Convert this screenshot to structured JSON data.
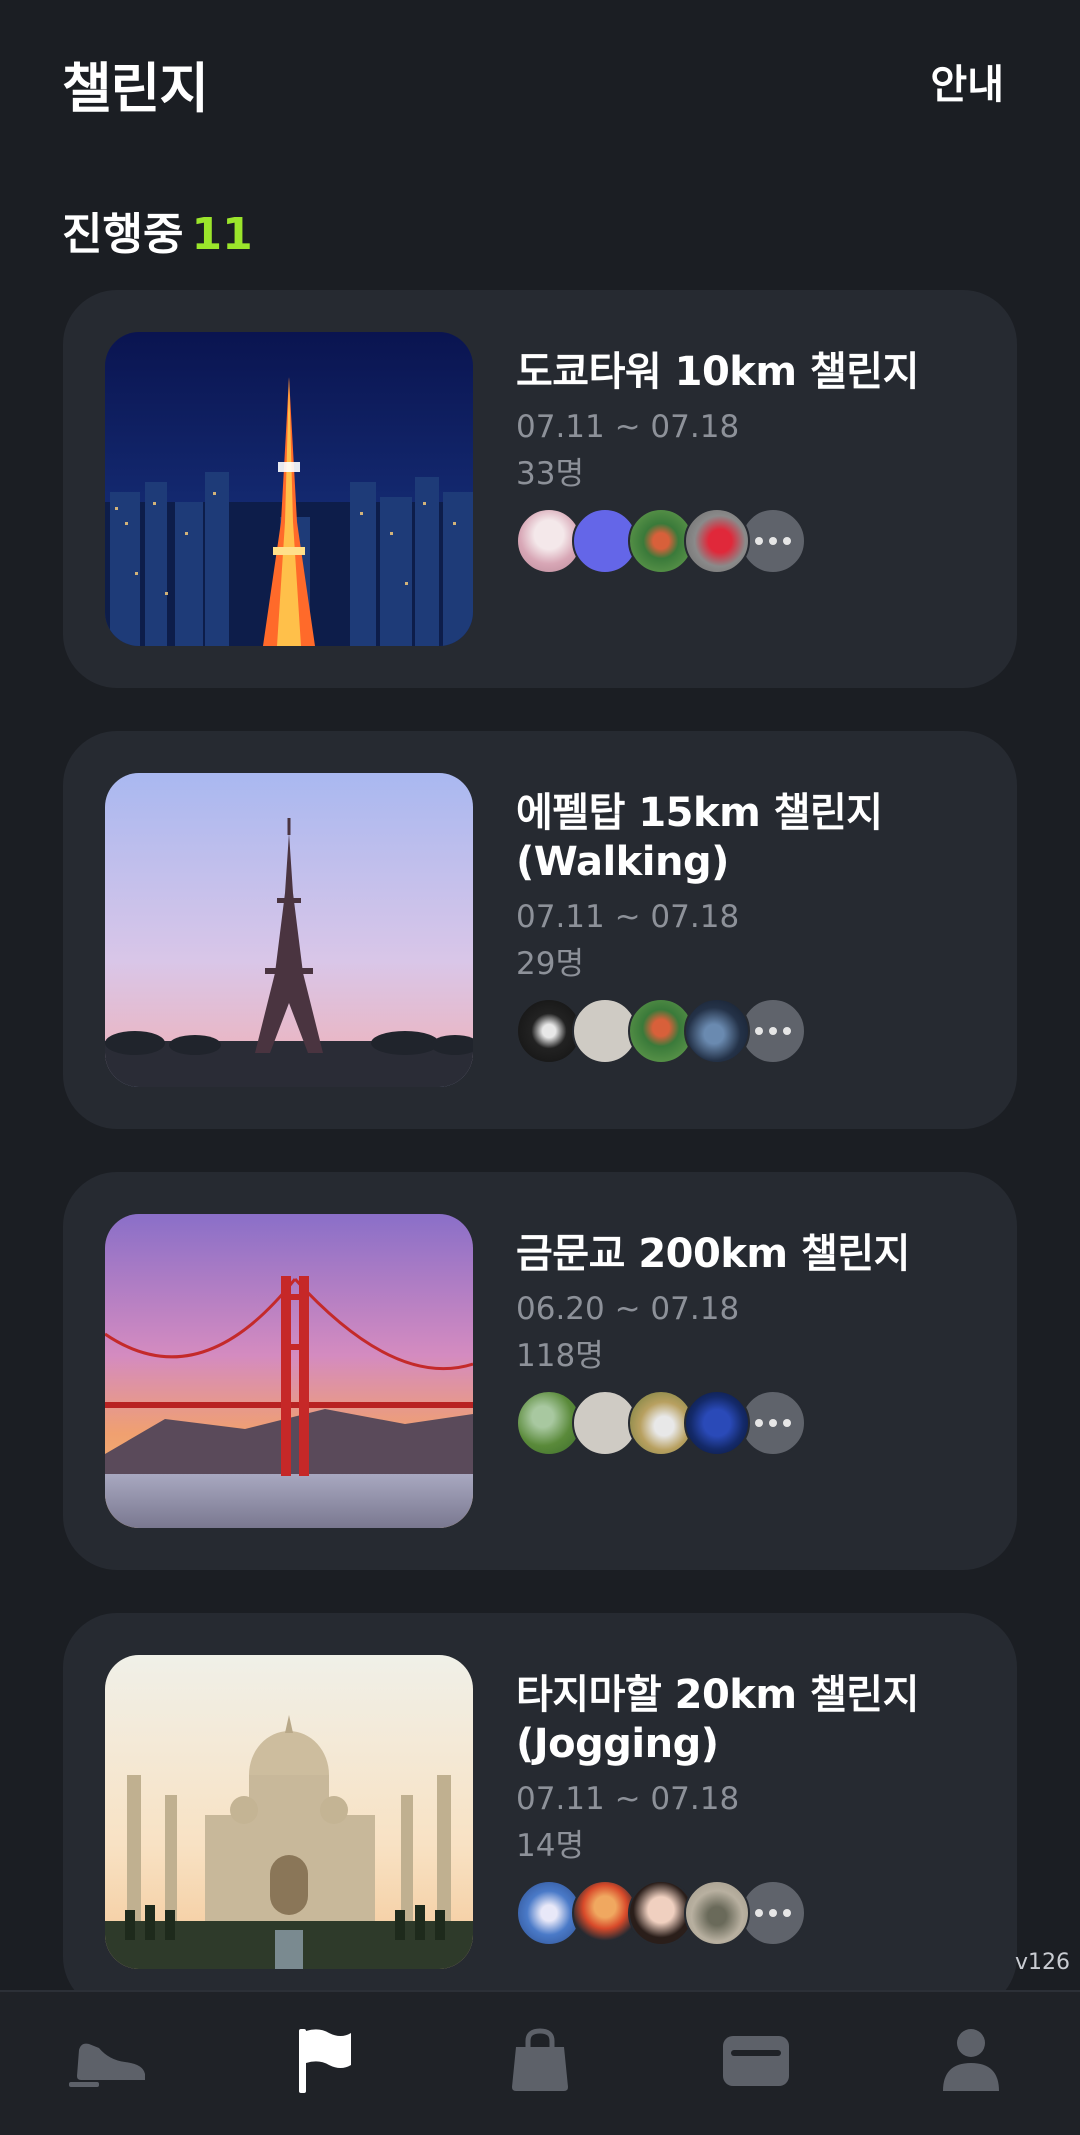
{
  "header": {
    "title": "챌린지",
    "guide_label": "안내"
  },
  "section": {
    "label": "진행중",
    "count": "11"
  },
  "challenges": [
    {
      "title": "도쿄타워 10km 챌린지",
      "dates": "07.11 ~ 07.18",
      "members": "33명"
    },
    {
      "title": "에펠탑 15km 챌린지 (Walking)",
      "dates": "07.11 ~ 07.18",
      "members": "29명"
    },
    {
      "title": "금문교 200km 챌린지",
      "dates": "06.20 ~ 07.18",
      "members": "118명"
    },
    {
      "title": "타지마할 20km 챌린지 (Jogging)",
      "dates": "07.11 ~ 07.18",
      "members": "14명"
    }
  ],
  "version": "v126",
  "tabs": [
    {
      "icon": "shoe-icon",
      "active": false
    },
    {
      "icon": "flag-icon",
      "active": true
    },
    {
      "icon": "shopping-bag-icon",
      "active": false
    },
    {
      "icon": "wallet-icon",
      "active": false
    },
    {
      "icon": "profile-icon",
      "active": false
    }
  ],
  "colors": {
    "background": "#1b1e23",
    "card": "#262a31",
    "accent": "#9be52b",
    "muted": "#8d9199"
  }
}
